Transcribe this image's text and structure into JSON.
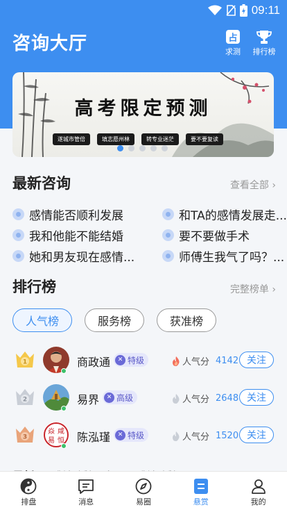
{
  "status": {
    "time": "09:11"
  },
  "header": {
    "title": "咨询大厅",
    "qiuce_label": "求测",
    "rank_label": "排行榜",
    "qiuce_icon": "divination-icon",
    "rank_icon": "trophy-icon"
  },
  "banner": {
    "title": "高考限定预测",
    "tags": [
      "遂城市管倍",
      "填志愿州林",
      "转专业迷茫",
      "要不要复读"
    ],
    "slide_count": 5,
    "active_slide": 1
  },
  "latest": {
    "heading": "最新咨询",
    "more": "查看全部",
    "items": [
      "感情能否顺利发展",
      "和TA的感情发展走...",
      "我和他能不能结婚",
      "要不要做手术",
      "她和男友现在感情...",
      "师傅生我气了吗？..."
    ]
  },
  "ranking": {
    "heading": "排行榜",
    "more": "完整榜单",
    "tabs": [
      "人气榜",
      "服务榜",
      "获准榜"
    ],
    "active_tab": 0,
    "popularity_label": "人气分",
    "follow_label": "关注",
    "rows": [
      {
        "name": "商政通",
        "level": "特级",
        "score": "4142",
        "medal": "gold"
      },
      {
        "name": "易界",
        "level": "高级",
        "score": "2648",
        "medal": "silver"
      },
      {
        "name": "陈泓瑾",
        "level": "特级",
        "score": "1520",
        "medal": "bronze"
      }
    ],
    "avatar3_text": [
      "焱",
      "咸",
      "易",
      "恒"
    ]
  },
  "partial_tabs": [
    "最新",
    "感情·婚姻(女)",
    "感情·婚姻(男)"
  ],
  "tabbar": {
    "items": [
      "排盘",
      "消息",
      "易圈",
      "悬赏",
      "我的"
    ],
    "active": 3
  },
  "colors": {
    "accent": "#3d8ef0",
    "online": "#3cc16b",
    "badge": "#6a6ad7"
  }
}
